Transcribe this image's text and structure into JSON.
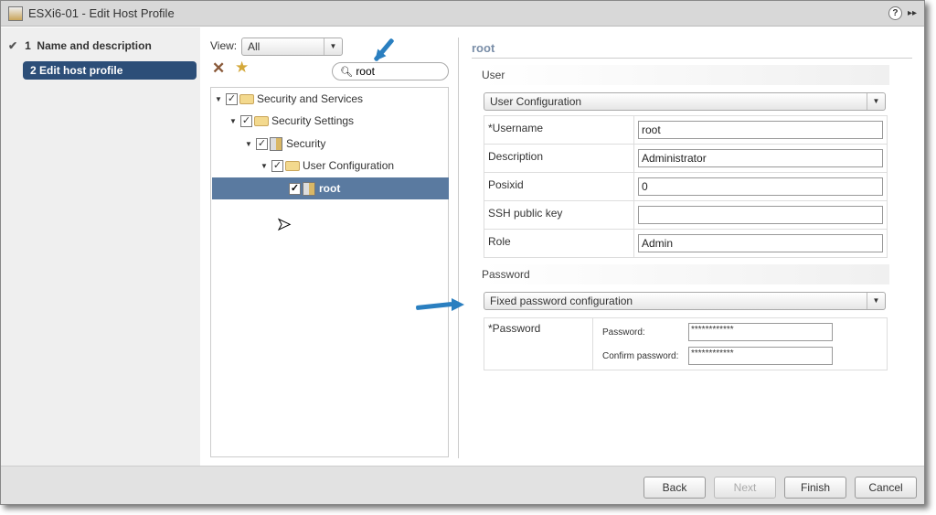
{
  "window": {
    "title": "ESXi6-01 - Edit Host Profile",
    "help_icon": "?",
    "expand_icon": "▸▸"
  },
  "steps": [
    {
      "number": "1",
      "label": "Name and description",
      "done": true
    },
    {
      "number": "2",
      "label": "Edit host profile",
      "active": true
    }
  ],
  "filter": {
    "view_label": "View:",
    "view_value": "All",
    "search_value": "root"
  },
  "tree": [
    {
      "label": "Security and Services",
      "icon": "folder-icon",
      "checked": true
    },
    {
      "label": "Security Settings",
      "icon": "folder-icon",
      "checked": true
    },
    {
      "label": "Security",
      "icon": "host-profile-icon",
      "checked": true
    },
    {
      "label": "User Configuration",
      "icon": "folder-icon",
      "checked": true
    },
    {
      "label": "root",
      "icon": "host-profile-icon",
      "checked": true,
      "selected": true
    }
  ],
  "detail": {
    "title": "root",
    "user_section": "User",
    "user_dropdown": "User Configuration",
    "fields": [
      {
        "label": "*Username",
        "value": "root"
      },
      {
        "label": "Description",
        "value": "Administrator"
      },
      {
        "label": "Posixid",
        "value": "0"
      },
      {
        "label": "SSH public key",
        "value": ""
      },
      {
        "label": "Role",
        "value": "Admin"
      }
    ],
    "password_section": "Password",
    "password_dropdown": "Fixed password configuration",
    "password_label": "*Password",
    "password_sub": "Password:",
    "password_value": "************",
    "confirm_sub": "Confirm password:",
    "confirm_value": "************"
  },
  "buttons": {
    "back": "Back",
    "next": "Next",
    "finish": "Finish",
    "cancel": "Cancel"
  },
  "colors": {
    "active_step": "#2c4e78",
    "selected_row": "#5a7aa0",
    "annotation_arrow": "#2a7fc0"
  }
}
